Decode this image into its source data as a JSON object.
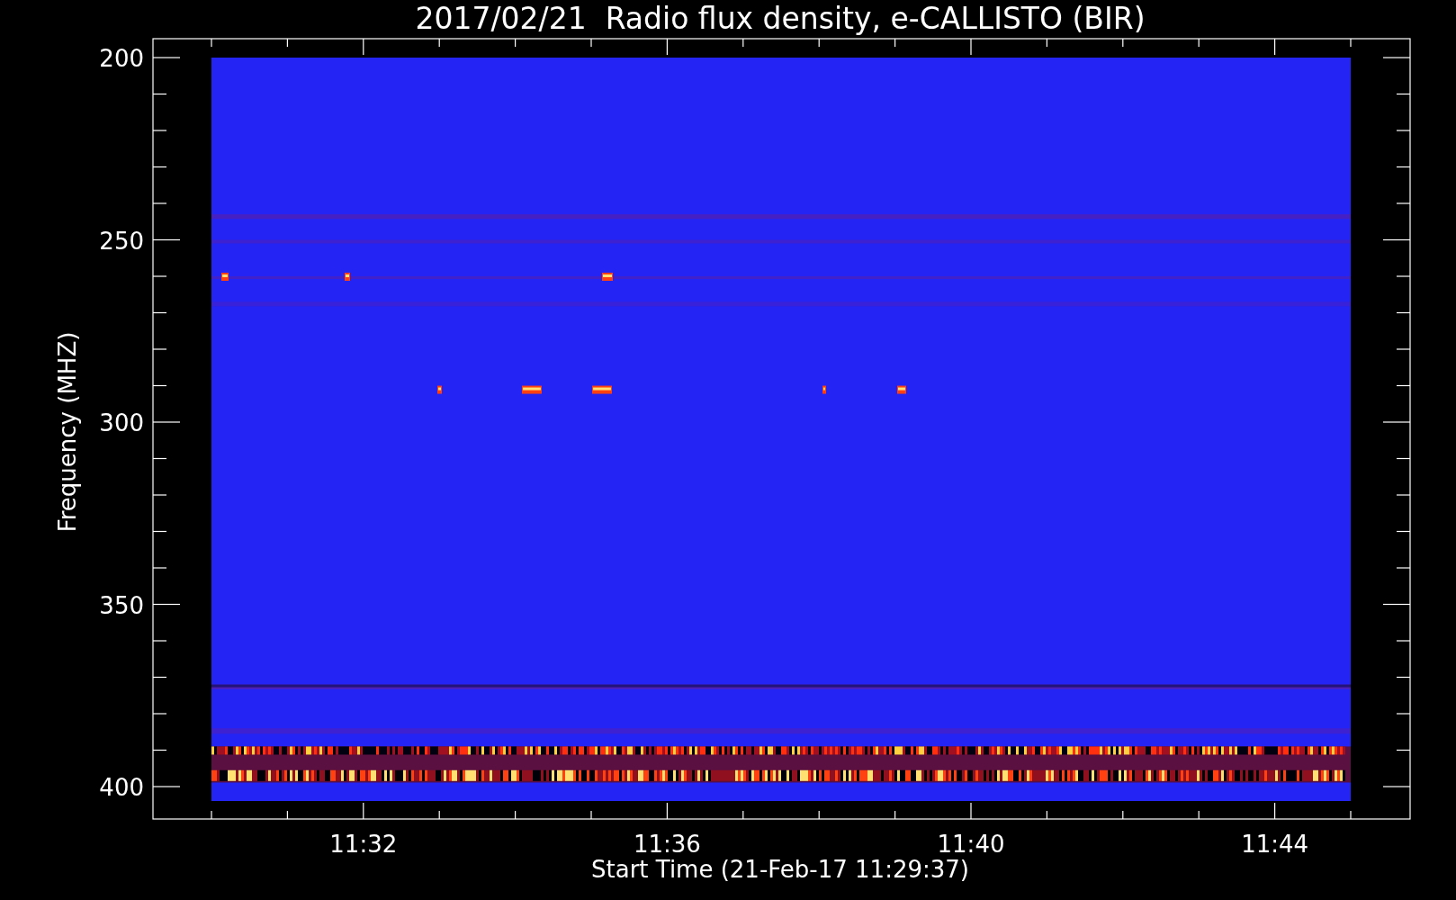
{
  "title": "2017/02/21  Radio flux density, e-CALLISTO (BIR)",
  "y_axis": {
    "label": "Frequency (MHZ)",
    "ticks": [
      "200",
      "250",
      "300",
      "350",
      "400"
    ]
  },
  "x_axis": {
    "label": "Start Time (21-Feb-17 11:29:37)",
    "ticks": [
      "11:32",
      "11:36",
      "11:40",
      "11:44"
    ]
  }
}
